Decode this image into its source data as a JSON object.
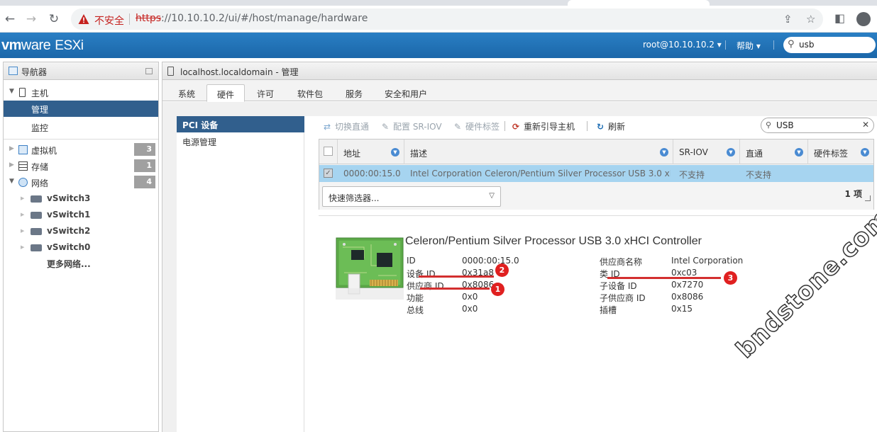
{
  "browser": {
    "security_label": "不安全",
    "url_scheme": "https",
    "url_rest": "://10.10.10.2/ui/#/host/manage/hardware"
  },
  "header": {
    "logo_vm": "vm",
    "logo_ware": "ware",
    "logo_product": "ESXi",
    "user": "root@10.10.10.2 ▾",
    "help": "帮助 ▾",
    "search_value": "usb"
  },
  "navigator": {
    "title": "导航器",
    "host": "主机",
    "manage": "管理",
    "monitor": "监控",
    "vms": "虚拟机",
    "vms_count": "3",
    "storage": "存储",
    "storage_count": "1",
    "network": "网络",
    "network_count": "4",
    "switches": [
      "vSwitch3",
      "vSwitch1",
      "vSwitch2",
      "vSwitch0"
    ],
    "more_networks": "更多网络..."
  },
  "main": {
    "title": "localhost.localdomain - 管理",
    "tabs": [
      "系统",
      "硬件",
      "许可",
      "软件包",
      "服务",
      "安全和用户"
    ],
    "side_menu": [
      "PCI 设备",
      "电源管理"
    ]
  },
  "toolbar": {
    "passthrough": "切换直通",
    "sriov": "配置 SR-IOV",
    "hw_label": "硬件标签",
    "reboot": "重新引导主机",
    "refresh": "刷新",
    "filter_value": "USB"
  },
  "grid": {
    "headers": [
      "地址",
      "描述",
      "SR-IOV",
      "直通",
      "硬件标签"
    ],
    "row": {
      "address": "0000:00:15.0",
      "description": "Intel Corporation Celeron/Pentium Silver Processor USB 3.0 xHCI...",
      "sriov": "不支持",
      "passthrough": "不支持",
      "hw_label": ""
    },
    "quick_filter": "快速筛选器...",
    "count": "1 项"
  },
  "detail": {
    "title": "Celeron/Pentium Silver Processor USB 3.0 xHCI Controller",
    "left": [
      {
        "k": "ID",
        "v": "0000:00:15.0"
      },
      {
        "k": "设备 ID",
        "v": "0x31a8"
      },
      {
        "k": "供应商 ID",
        "v": "0x8086"
      },
      {
        "k": "功能",
        "v": "0x0"
      },
      {
        "k": "总线",
        "v": "0x0"
      }
    ],
    "right": [
      {
        "k": "供应商名称",
        "v": "Intel Corporation"
      },
      {
        "k": "类 ID",
        "v": "0xc03"
      },
      {
        "k": "子设备 ID",
        "v": "0x7270"
      },
      {
        "k": "子供应商 ID",
        "v": "0x8086"
      },
      {
        "k": "插槽",
        "v": "0x15"
      }
    ]
  },
  "annotations": [
    "1",
    "2",
    "3"
  ],
  "watermark": "bndstone.com",
  "colors": {
    "header_blue": "#1b67a9",
    "selected_nav": "#315f8d",
    "row_selected": "#a6d4f0",
    "annotation_red": "#e02020"
  }
}
